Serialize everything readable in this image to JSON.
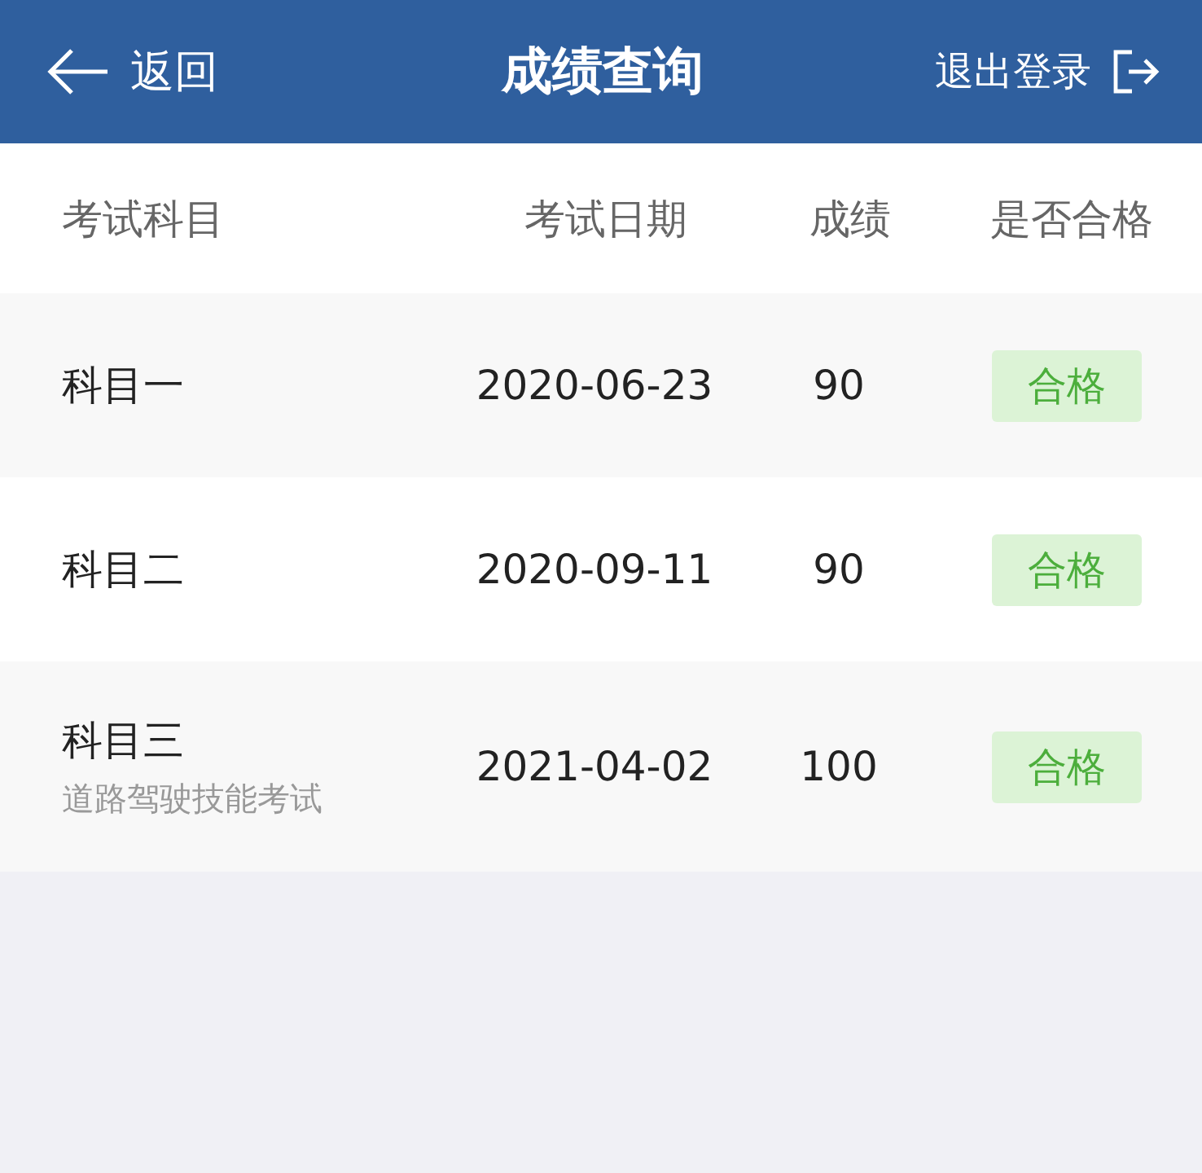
{
  "header": {
    "back": "返回",
    "title": "成绩查询",
    "logout": "退出登录"
  },
  "columns": [
    "考试科目",
    "考试日期",
    "成绩",
    "是否合格"
  ],
  "rows": [
    {
      "subject": "科目一",
      "date": "2020-06-23",
      "score": "90",
      "result": "合格",
      "passed": true
    },
    {
      "subject": "科目二",
      "date": "2020-09-11",
      "score": "90",
      "result": "合格",
      "passed": true
    },
    {
      "subject": "科目三",
      "subtitle": "道路驾驶技能考试",
      "date": "2021-04-02",
      "score": "100",
      "result": "合格",
      "passed": true
    }
  ]
}
